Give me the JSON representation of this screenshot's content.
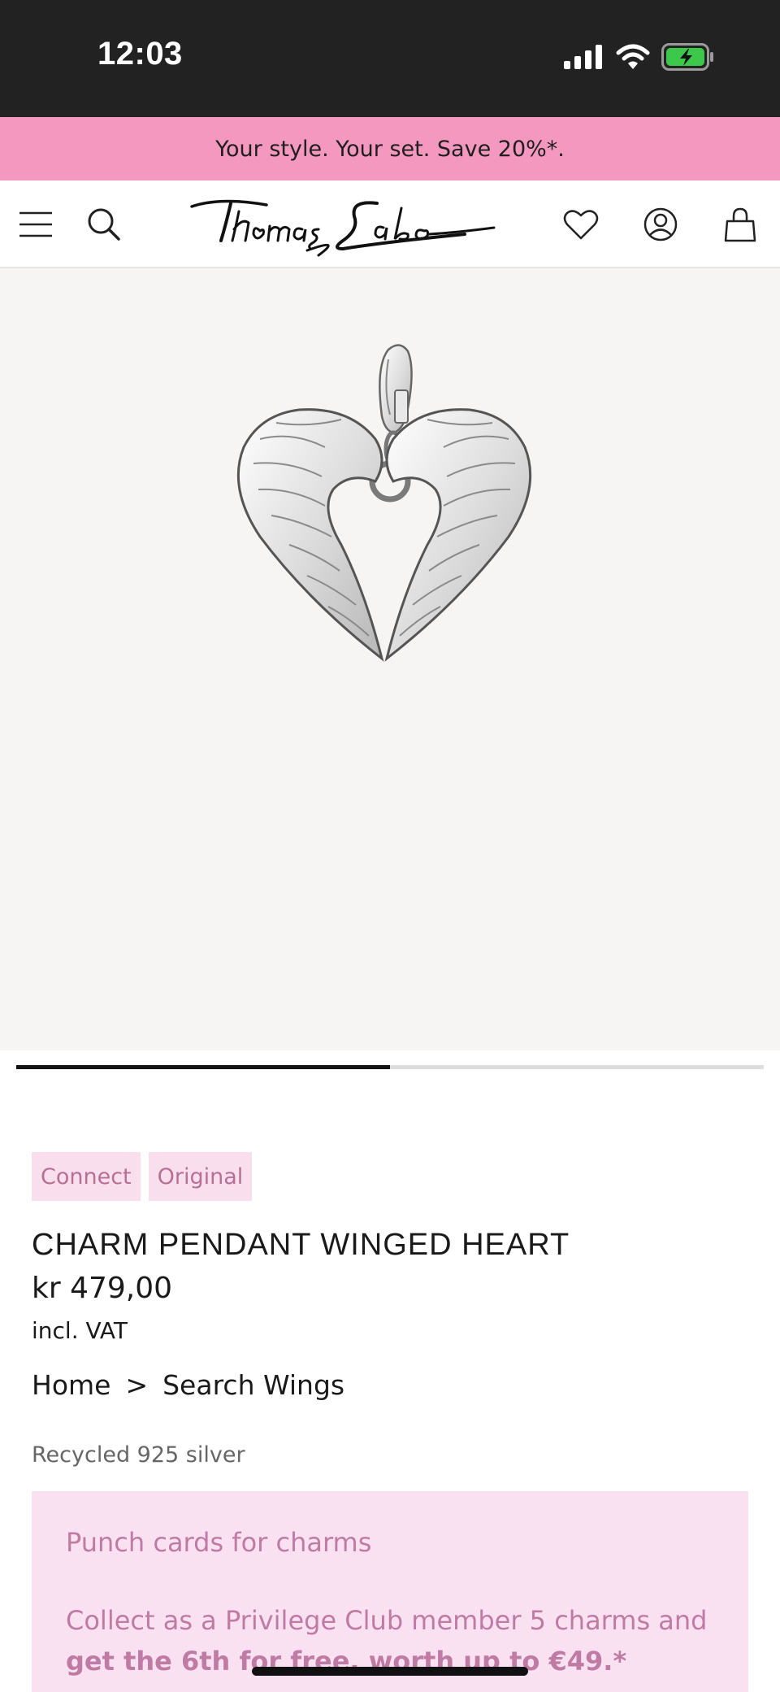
{
  "status_bar": {
    "time": "12:03",
    "icons": [
      "signal-icon",
      "wifi-icon",
      "battery-charging-icon"
    ]
  },
  "promo_banner": {
    "text": "Your style. Your set. Save 20%*."
  },
  "header": {
    "logo_text": "Thomas Sabo",
    "icons": [
      "menu-icon",
      "search-icon",
      "heart-icon",
      "account-icon",
      "bag-icon"
    ]
  },
  "carousel": {
    "progress": 0.5
  },
  "product": {
    "tags": [
      "Connect",
      "Original"
    ],
    "title": "CHARM PENDANT WINGED HEART",
    "price": "kr 479,00",
    "vat_note": "incl. VAT",
    "material": "Recycled 925 silver"
  },
  "breadcrumb": {
    "home": "Home",
    "separator": ">",
    "current": "Search Wings"
  },
  "punch_card": {
    "title": "Punch cards for charms",
    "text_regular": "Collect as a Privilege Club member 5 charms and ",
    "text_bold": "get the 6th for free, worth up to €49.*"
  },
  "colors": {
    "status_bar": "#222222",
    "promo_bg": "#f598bf",
    "tag_bg": "#f9dfee",
    "tag_text": "#b76f95",
    "punch_bg": "#f9e1f1",
    "punch_text": "#bf7ba4",
    "hero_bg": "#f6f5f4"
  }
}
